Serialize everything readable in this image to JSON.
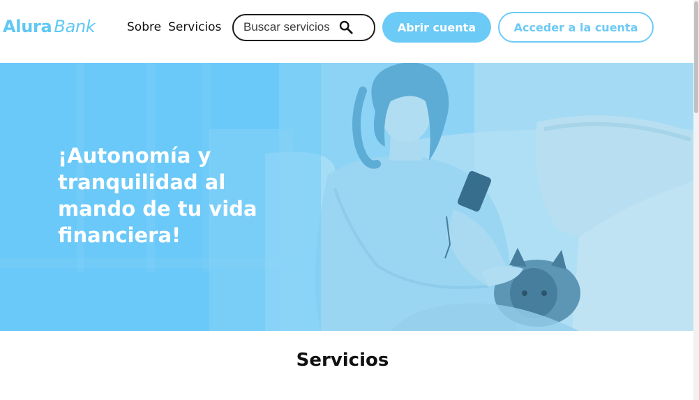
{
  "header": {
    "logo": {
      "primary": "Alura",
      "secondary": "Bank"
    },
    "nav": [
      {
        "label": "Sobre"
      },
      {
        "label": "Servicios"
      }
    ],
    "search": {
      "placeholder": "Buscar servicios",
      "value": "",
      "icon": "search-icon"
    },
    "buttons": {
      "open_account": "Abrir cuenta",
      "access_account": "Acceder a la cuenta"
    }
  },
  "hero": {
    "title": "¡Autonomía y tranquilidad al mando de tu vida financiera!"
  },
  "services": {
    "title": "Servicios"
  },
  "colors": {
    "brand": "#6ccaf7",
    "text": "#111111",
    "hero_overlay": "#68c9f8"
  }
}
